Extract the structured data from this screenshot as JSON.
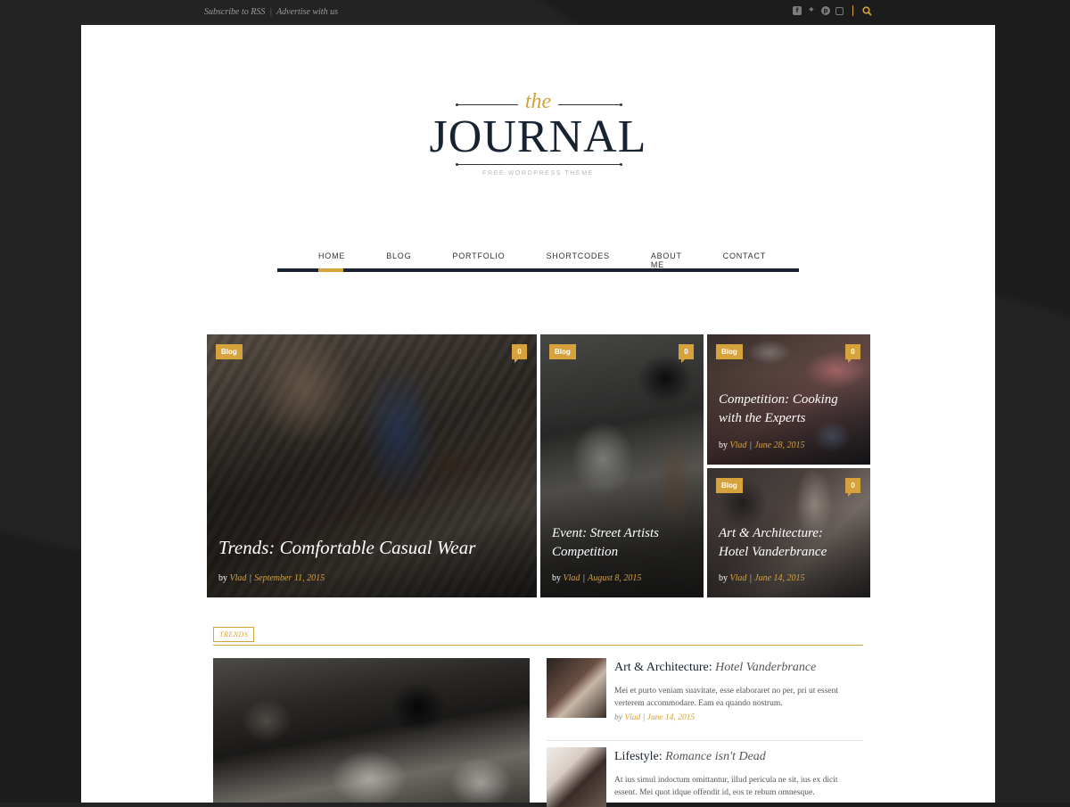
{
  "topbar": {
    "links": [
      "Subscribe to RSS",
      "Advertise with us"
    ],
    "social_icons": [
      "facebook-icon",
      "twitter-icon",
      "pinterest-icon",
      "instagram-icon"
    ],
    "search_icon": "search-icon"
  },
  "logo": {
    "the": "the",
    "name": "JOURNAL",
    "tagline": "FREE WORDPRESS THEME"
  },
  "nav": {
    "items": [
      "HOME",
      "BLOG",
      "PORTFOLIO",
      "SHORTCODES",
      "ABOUT ME",
      "CONTACT"
    ],
    "active": "HOME"
  },
  "featured": [
    {
      "category": "Blog",
      "comments": "0",
      "title": "Trends: Comfortable Casual Wear",
      "by": "by",
      "author": "Vlad",
      "date": "September 11, 2015"
    },
    {
      "category": "Blog",
      "comments": "0",
      "title_line1": "Event: Street Artists",
      "title_line2": "Competition",
      "by": "by",
      "author": "Vlad",
      "date": "August 8, 2015"
    },
    {
      "category": "Blog",
      "comments": "0",
      "title_line1": "Competition: Cooking",
      "title_line2": "with the Experts",
      "by": "by",
      "author": "Vlad",
      "date": "June 28, 2015"
    },
    {
      "category": "Blog",
      "comments": "0",
      "title_line1": "Art & Architecture:",
      "title_line2": "Hotel Vanderbrance",
      "by": "by",
      "author": "Vlad",
      "date": "June 14, 2015"
    }
  ],
  "trends": {
    "label": "TRENDS",
    "posts": [
      {
        "title_bold": "Art & Architecture:",
        "title_rest": "Hotel Vanderbrance",
        "excerpt": "Mei et purto veniam suavitate, esse elaboraret no per, pri ut essent verterem accommodare. Eam ea quando nostrum.",
        "by": "by",
        "author": "Vlad",
        "date": "June 14, 2015"
      },
      {
        "title_bold": "Lifestyle:",
        "title_rest": "Romance isn't Dead",
        "excerpt": "At ius simul indoctum omittantur, illud pericula ne sit, ius ex dicit essent. Mei quot idque offendit id, eos te rebum omnesque."
      }
    ]
  },
  "colors": {
    "accent": "#d6a23c",
    "navy": "#172330",
    "background": "#1c1c1c"
  }
}
